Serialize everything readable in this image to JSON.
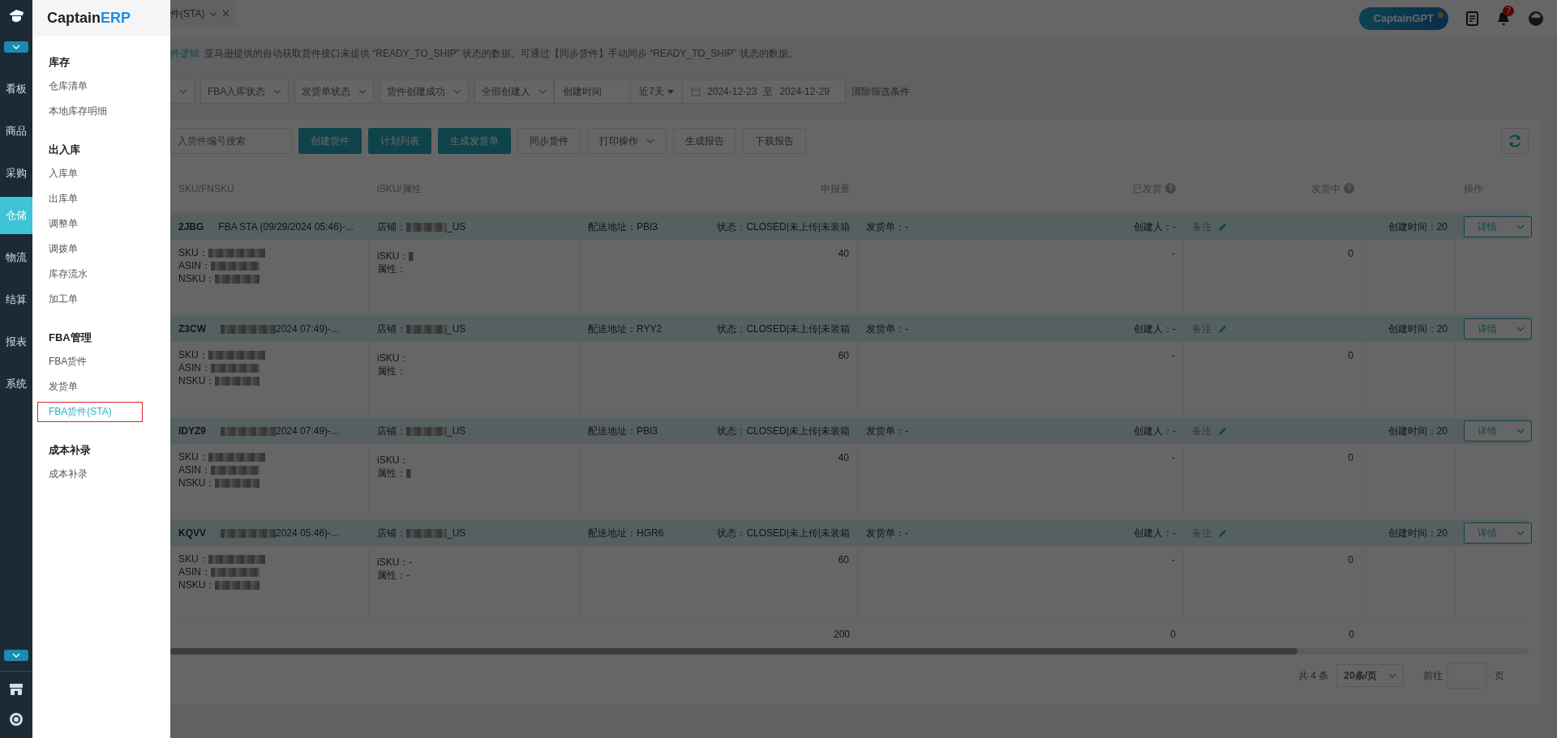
{
  "rail": {
    "items": [
      {
        "label": "看板",
        "selected": false
      },
      {
        "label": "商品",
        "selected": false
      },
      {
        "label": "采购",
        "selected": false
      },
      {
        "label": "仓储",
        "selected": true
      },
      {
        "label": "物流",
        "selected": false
      },
      {
        "label": "结算",
        "selected": false
      },
      {
        "label": "报表",
        "selected": false
      },
      {
        "label": "系统",
        "selected": false
      }
    ]
  },
  "menu": {
    "logo": "Captain",
    "logo_accent": "ERP",
    "groups": [
      {
        "title": "库存",
        "items": [
          {
            "label": "仓库清单",
            "selected": false
          },
          {
            "label": "本地库存明细",
            "selected": false
          }
        ]
      },
      {
        "title": "出入库",
        "items": [
          {
            "label": "入库单",
            "selected": false
          },
          {
            "label": "出库单",
            "selected": false
          },
          {
            "label": "调整单",
            "selected": false
          },
          {
            "label": "调拨单",
            "selected": false
          },
          {
            "label": "库存流水",
            "selected": false
          },
          {
            "label": "加工单",
            "selected": false
          }
        ]
      },
      {
        "title": "FBA管理",
        "items": [
          {
            "label": "FBA货件",
            "selected": false
          },
          {
            "label": "发货单",
            "selected": false
          },
          {
            "label": "FBA货件(STA)",
            "selected": true
          }
        ]
      },
      {
        "title": "成本补录",
        "items": [
          {
            "label": "成本补录",
            "selected": false
          }
        ]
      }
    ]
  },
  "topbar": {
    "tab": "件(STA)",
    "gpt": "CaptainGPT",
    "notifications": "7"
  },
  "notice": {
    "link": "件逻辑",
    "text": "亚马逊提供的自动获取货件接口未提供 “READY_TO_SHIP” 状态的数据。可通过【同步货件】手动同步 “READY_TO_SHIP” 状态的数据。"
  },
  "filters": {
    "selects": [
      "FBA入库状态",
      "发货单状态",
      "货件创建成功",
      "全部创建人"
    ],
    "date_label": "创建时间",
    "preset": "近7天",
    "start": "2024-12-23",
    "separator": "至",
    "end": "2024-12-29",
    "clear": "清除筛选条件"
  },
  "toolbar": {
    "search_placeholder": "入货件编号搜索",
    "buttons": [
      {
        "label": "创建货件",
        "kind": "primary"
      },
      {
        "label": "计划列表",
        "kind": "primary"
      },
      {
        "label": "生成发货单",
        "kind": "primary"
      },
      {
        "label": "同步货件",
        "kind": "plain"
      },
      {
        "label": "打印操作",
        "kind": "dropdown"
      },
      {
        "label": "生成报告",
        "kind": "plain"
      },
      {
        "label": "下载报告",
        "kind": "plain"
      }
    ]
  },
  "table": {
    "columns": [
      {
        "label": "SKU/FNSKU"
      },
      {
        "label": "iSKU/属性"
      },
      {
        "label": "申报量"
      },
      {
        "label": "已发货",
        "help": "?"
      },
      {
        "label": "发货中",
        "help": "?"
      },
      {
        "label": "操作"
      }
    ],
    "rows": [
      {
        "id": "2JBG",
        "name": "FBA STA (09/29/2024 05:46)-...",
        "name_redacted": false,
        "store_label": "店铺：",
        "store": "_US",
        "address": "配送地址：PBI3",
        "status": "状态：CLOSED|未上传|未装箱",
        "shipment": "发货单：-",
        "creator": "创建人：-",
        "remark": "备注",
        "created": "创建时间：20",
        "action": "详情",
        "sku": "SKU：",
        "asin": "ASIN：",
        "fnsku": "NSKU：",
        "isku": "iSKU：",
        "isku_redacted": true,
        "attr": "属性：",
        "attr_redacted": false,
        "declared": "40",
        "shipped": "-",
        "shipping": "0"
      },
      {
        "id": "Z3CW",
        "name": "2024 07:49)-...",
        "name_redacted": true,
        "store_label": "店铺：",
        "store": "_US",
        "address": "配送地址：RYY2",
        "status": "状态：CLOSED|未上传|未装箱",
        "shipment": "发货单：-",
        "creator": "创建人：-",
        "remark": "备注",
        "created": "创建时间：20",
        "action": "详情",
        "sku": "SKU：",
        "asin": "ASIN：",
        "fnsku": "NSKU：",
        "isku": "iSKU：",
        "isku_redacted": false,
        "attr": "属性：",
        "attr_redacted": false,
        "declared": "60",
        "shipped": "-",
        "shipping": "0"
      },
      {
        "id": "IDYZ9",
        "name": "2024 07:49)-...",
        "name_redacted": true,
        "store_label": "店铺：",
        "store": "_US",
        "address": "配送地址：PBI3",
        "status": "状态：CLOSED|未上传|未装箱",
        "shipment": "发货单：-",
        "creator": "创建人：-",
        "remark": "备注",
        "created": "创建时间：20",
        "action": "详情",
        "sku": "SKU：",
        "asin": "ASIN：",
        "fnsku": "NSKU：",
        "isku": "iSKU：",
        "isku_redacted": false,
        "attr": "属性：",
        "attr_redacted": true,
        "declared": "40",
        "shipped": "-",
        "shipping": "0"
      },
      {
        "id": "KQVV",
        "name": "2024 05:46)-...",
        "name_redacted": true,
        "store_label": "店铺：",
        "store": "_US",
        "address": "配送地址：HGR6",
        "status": "状态：CLOSED|未上传|未装箱",
        "shipment": "发货单：-",
        "creator": "创建人：-",
        "remark": "备注",
        "created": "创建时间：20",
        "action": "详情",
        "sku": "SKU：",
        "asin": "ASIN：",
        "fnsku": "NSKU：",
        "isku": "iSKU：-",
        "isku_redacted": false,
        "attr": "属性：-",
        "attr_redacted": false,
        "declared": "60",
        "shipped": "-",
        "shipping": "0"
      }
    ],
    "summary": {
      "declared": "200",
      "shipped": "0",
      "shipping": "0"
    }
  },
  "pagination": {
    "total": "共 4 条",
    "page_size": "20条/页",
    "goto": "前往",
    "suffix": "页"
  }
}
